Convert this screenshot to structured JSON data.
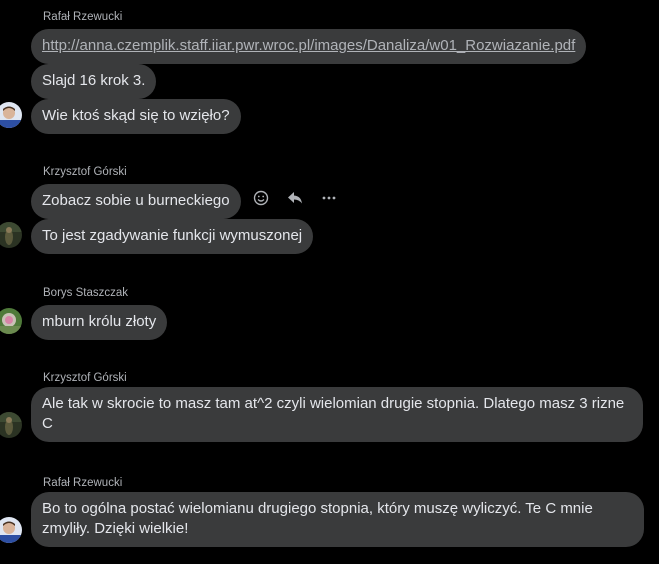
{
  "messages": [
    {
      "sender": "Rafał Rzewucki",
      "lines": [
        "http://anna.czemplik.staff.iiar.pwr.wroc.pl/images/Danaliza/w01_Rozwiazanie.pdf",
        "Slajd 16 krok 3.",
        "Wie ktoś skąd się to wzięło?"
      ]
    },
    {
      "sender": "Krzysztof Górski",
      "lines": [
        "Zobacz sobie u burneckiego",
        "To jest zgadywanie funkcji wymuszonej"
      ]
    },
    {
      "sender": "Borys Staszczak",
      "lines": [
        "mburn królu złoty"
      ]
    },
    {
      "sender": "Krzysztof Górski",
      "lines": [
        "Ale tak w skrocie to masz tam at^2 czyli wielomian drugie stopnia. Dlatego masz 3 rizne C"
      ]
    },
    {
      "sender": "Rafał Rzewucki",
      "lines": [
        "Bo to ogólna postać wielomianu drugiego stopnia, który muszę wyliczyć. Te C mnie zmyliły. Dzięki wielkie!"
      ]
    }
  ],
  "hover_actions": {
    "react_icon": "smiley-face-icon",
    "reply_icon": "reply-arrow-icon",
    "more_icon": "more-dots-icon"
  },
  "colors": {
    "background": "#000000",
    "bubble": "#3a3b3c",
    "text": "#e4e6eb",
    "sender": "#b0b3b8",
    "link": "#b0b3b8"
  }
}
